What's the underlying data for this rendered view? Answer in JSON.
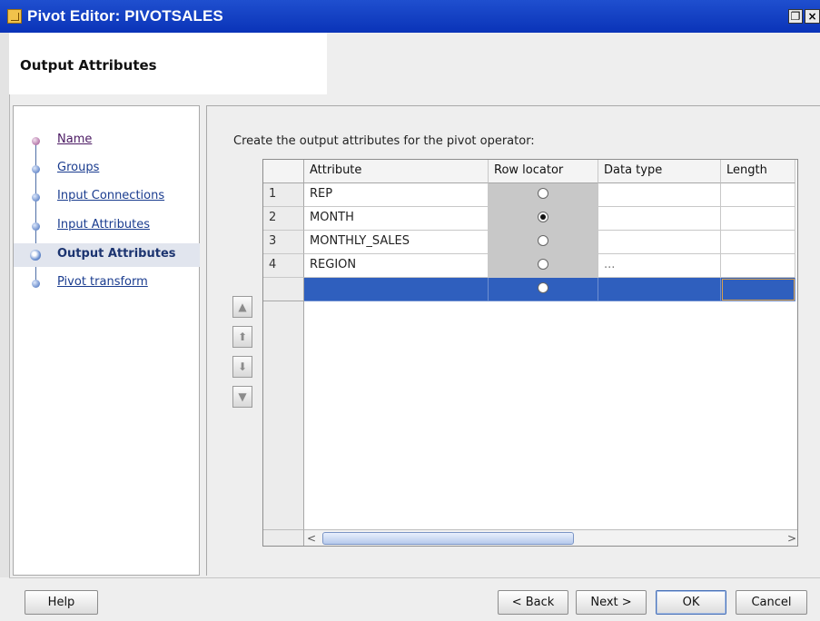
{
  "window": {
    "title": "Pivot Editor: PIVOTSALES",
    "restore_glyph": "❐",
    "close_glyph": "×",
    "icon": "pivot-editor-app-icon"
  },
  "header": {
    "title": "Output Attributes"
  },
  "wizard_steps": [
    {
      "label": "Name",
      "state": "visited"
    },
    {
      "label": "Groups",
      "state": "link"
    },
    {
      "label": "Input Connections",
      "state": "link"
    },
    {
      "label": "Input Attributes",
      "state": "link"
    },
    {
      "label": "Output Attributes",
      "state": "active"
    },
    {
      "label": "Pivot transform",
      "state": "link"
    }
  ],
  "main": {
    "instruction": "Create the output attributes for the pivot operator:",
    "move_buttons": {
      "top": "▲",
      "up": "⬆",
      "down": "⬇",
      "bottom": "▼"
    },
    "table": {
      "columns": [
        "Attribute",
        "Row locator",
        "Data type",
        "Length"
      ],
      "rows": [
        {
          "num": "1",
          "attribute": "REP",
          "row_locator": false,
          "data_type": "",
          "length": ""
        },
        {
          "num": "2",
          "attribute": "MONTH",
          "row_locator": true,
          "data_type": "",
          "length": ""
        },
        {
          "num": "3",
          "attribute": "MONTHLY_SALES",
          "row_locator": false,
          "data_type": "",
          "length": ""
        },
        {
          "num": "4",
          "attribute": "REGION",
          "row_locator": false,
          "data_type": "...",
          "length": ""
        },
        {
          "num": "",
          "attribute": "",
          "row_locator": false,
          "data_type": "",
          "length": "",
          "selected": true
        }
      ],
      "scroll_left": "<",
      "scroll_right": ">"
    }
  },
  "footer": {
    "help": "Help",
    "back": "< Back",
    "next": "Next >",
    "ok": "OK",
    "cancel": "Cancel"
  },
  "colors": {
    "titlebar": "#0a33b8",
    "selection": "#2f5fbe",
    "row_locator_bg": "#c8c8c8"
  }
}
